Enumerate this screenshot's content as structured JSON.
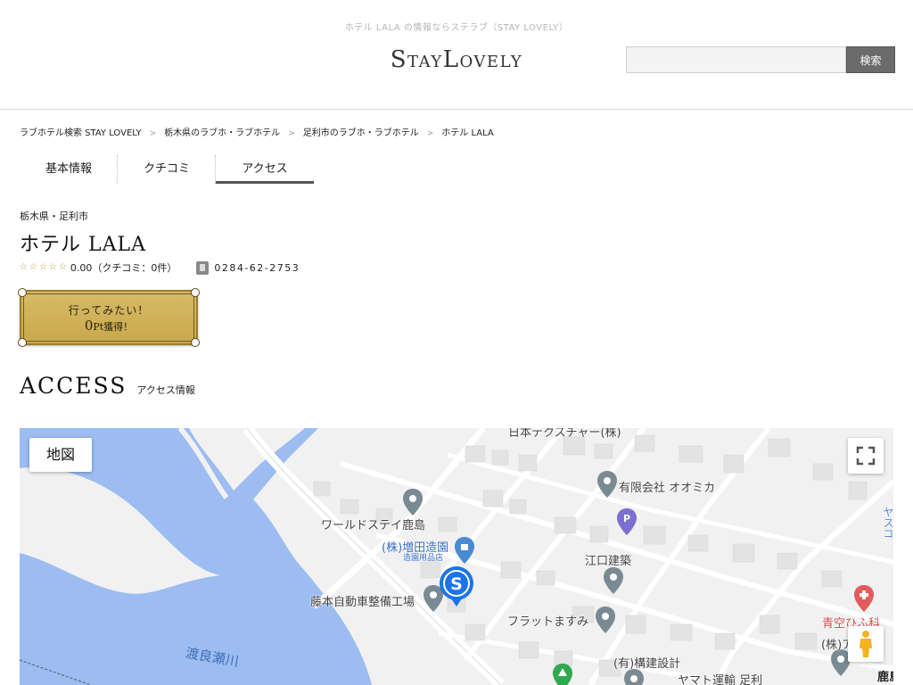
{
  "header": {
    "tagline": "ホテル LALA の情報ならステラブ（STAY LOVELY）",
    "logo": "StayLovely",
    "search_placeholder": "",
    "search_button": "検索"
  },
  "breadcrumb": [
    "ラブホテル検索 STAY LOVELY",
    "栃木県のラブホ・ラブホテル",
    "足利市のラブホ・ラブホテル",
    "ホテル LALA"
  ],
  "breadcrumb_separator": ">",
  "tabs": [
    {
      "label": "基本情報",
      "active": false
    },
    {
      "label": "クチコミ",
      "active": false
    },
    {
      "label": "アクセス",
      "active": true
    }
  ],
  "hotel": {
    "location": "栃木県・足利市",
    "name": "ホテル LALA",
    "rating_text": "0.00（クチコミ：0件）",
    "stars_filled": 0,
    "stars_total": 5,
    "phone": "0284-62-2753"
  },
  "wish_button": {
    "line1": "行ってみたい！",
    "points": "0",
    "points_unit": "Pt",
    "line2_suffix": "獲得！"
  },
  "access": {
    "title_en": "ACCESS",
    "title_ja": "アクセス情報"
  },
  "map": {
    "type_button": "地図",
    "labels": {
      "world_stay": "ワールドステイ鹿島",
      "masuda": "(株)増田造園",
      "masuda_sub": "造園用品店",
      "fujimoto": "藤本自動車整備工場",
      "oomika": "有限会社 オオミカ",
      "eguchi": "江口建築",
      "flat": "フラットますみ",
      "kouken": "(有)構建設計",
      "yamato": "ヤマト運輸 足利",
      "aozora": "青空ひふ科",
      "company_right": "(株)ア",
      "kashima": "鹿島",
      "nihon_texture": "日本テクスチャー(株)",
      "river": "渡良瀬川",
      "side_text": "ヤスコ"
    },
    "colors": {
      "water": "#9cbcf2",
      "land": "#f1f1f1",
      "road": "#ffffff",
      "building": "#e3e3e3",
      "pin": "#7a8a92",
      "hotel_pin": "#1a73e8",
      "red_pin": "#e25c5c",
      "green_pin": "#2fa84f",
      "parking": "#7c6fd1"
    }
  }
}
